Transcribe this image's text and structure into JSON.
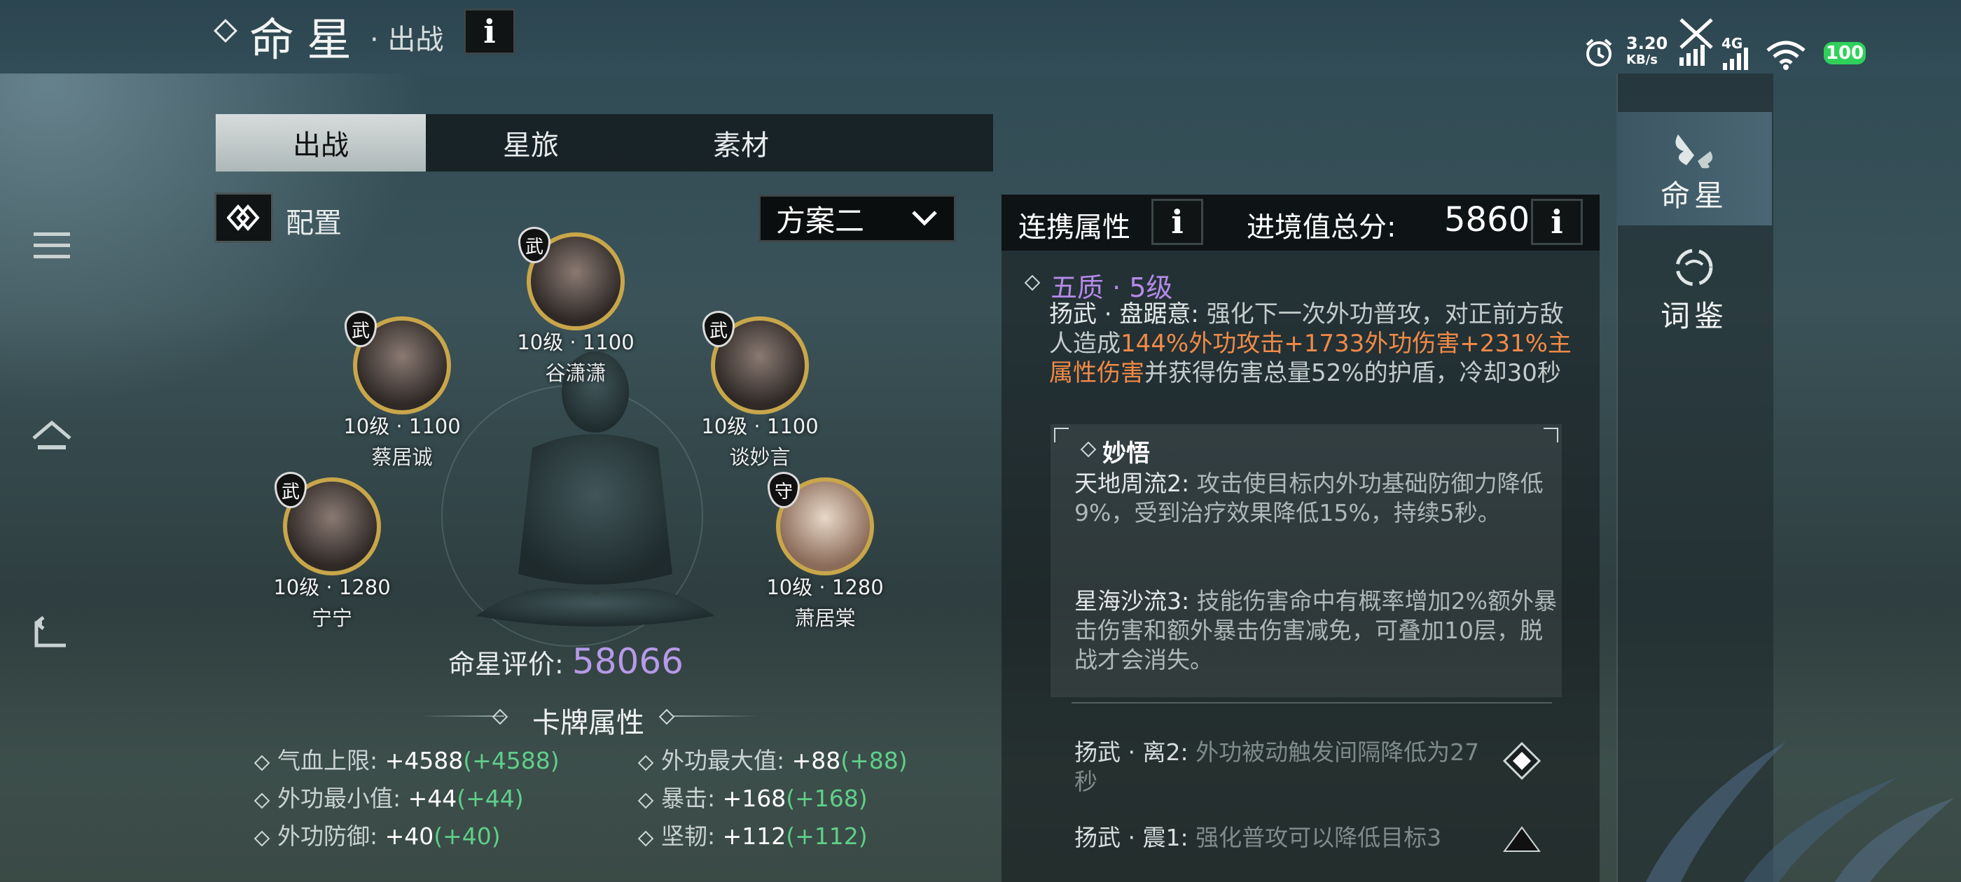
{
  "header": {
    "title": "命星",
    "subtitle": "· 出战",
    "info": "i"
  },
  "status_bar": {
    "net_speed_value": "3.20",
    "net_speed_unit": "KB/s",
    "signal_label": "4G",
    "battery": "100",
    "battery_color": "#2fd15a"
  },
  "tabs": [
    {
      "label": "出战",
      "active": true
    },
    {
      "label": "星旅",
      "active": false
    },
    {
      "label": "素材",
      "active": false
    }
  ],
  "config": {
    "label": "配置",
    "scheme": "方案二"
  },
  "characters": [
    {
      "name": "谷潇潇",
      "level": "10级 · 1100",
      "badge": "武"
    },
    {
      "name": "蔡居诚",
      "level": "10级 · 1100",
      "badge": "武"
    },
    {
      "name": "谈妙言",
      "level": "10级 · 1100",
      "badge": "武"
    },
    {
      "name": "宁宁",
      "level": "10级 · 1280",
      "badge": "武"
    },
    {
      "name": "萧居棠",
      "level": "10级 · 1280",
      "badge": "守"
    }
  ],
  "rating": {
    "label": "命星评价:",
    "value": "58066",
    "color": "#b69ae8"
  },
  "card_attributes": {
    "title": "卡牌属性",
    "items": [
      {
        "name": "气血上限:",
        "value": "+4588",
        "bonus": "(+4588)"
      },
      {
        "name": "外功最大值:",
        "value": "+88",
        "bonus": "(+88)"
      },
      {
        "name": "外功最小值:",
        "value": "+44",
        "bonus": "(+44)"
      },
      {
        "name": "暴击:",
        "value": "+168",
        "bonus": "(+168)"
      },
      {
        "name": "外功防御:",
        "value": "+40",
        "bonus": "(+40)"
      },
      {
        "name": "坚韧:",
        "value": "+112",
        "bonus": "(+112)"
      }
    ]
  },
  "right_panel": {
    "linked_attr_label": "连携属性",
    "score_label": "进境值总分:",
    "score_value": "5860",
    "quality": "五质 · 5级",
    "skill_name": "扬武 · 盘踞意:",
    "skill_desc_1": " 强化下一次外功普攻，对正前方敌人造成",
    "skill_desc_hl": "144%外功攻击+1733外功伤害+231%主属性伤害",
    "skill_desc_2": "并获得伤害总量52%的护盾，冷却30秒",
    "insight": {
      "title": "妙悟",
      "items": [
        {
          "name": "天地周流2:",
          "text": " 攻击使目标内外功基础防御力降低9%，受到治疗效果降低15%，持续5秒。"
        },
        {
          "name": "星海沙流3:",
          "text": " 技能伤害命中有概率增加2%额外暴击伤害和额外暴击伤害减免，可叠加10层，脱战才会消失。"
        }
      ]
    },
    "skills": [
      {
        "name": "扬武 · 离2:",
        "text": " 外功被动触发间隔降低为27秒",
        "icon": "diamond-icon"
      },
      {
        "name": "扬武 · 震1:",
        "text": " 强化普攻可以降低目标3",
        "icon": "triangle-icon"
      }
    ],
    "highlight_color": "#f08a48",
    "quality_color": "#b68ae8"
  },
  "right_nav": [
    {
      "label": "命星",
      "icon": "butterfly-icon",
      "active": true
    },
    {
      "label": "词鉴",
      "icon": "swirl-icon",
      "active": false
    }
  ]
}
